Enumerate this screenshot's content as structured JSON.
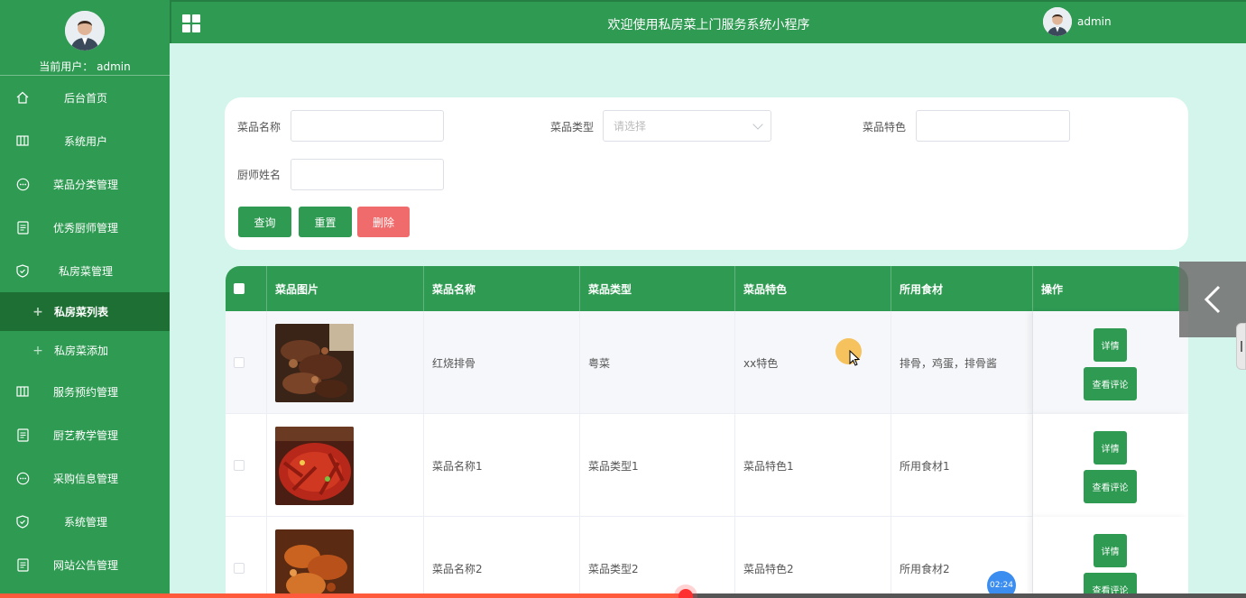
{
  "app": {
    "title": "欢迎使用私房菜上门服务系统小程序",
    "current_user_label": "当前用户： admin",
    "username": "admin"
  },
  "colors": {
    "primary": "#2e9a52",
    "active": "#1e6f34",
    "danger": "#f06b6b",
    "background": "#d4f5ec"
  },
  "sidebar": {
    "items": [
      {
        "label": "后台首页",
        "icon": "home-icon"
      },
      {
        "label": "系统用户",
        "icon": "columns-icon"
      },
      {
        "label": "菜品分类管理",
        "icon": "chat-icon"
      },
      {
        "label": "优秀厨师管理",
        "icon": "document-icon"
      },
      {
        "label": "私房菜管理",
        "icon": "shield-icon"
      }
    ],
    "sub_items": [
      {
        "label": "私房菜列表",
        "active": true
      },
      {
        "label": "私房菜添加",
        "active": false
      }
    ],
    "items_after": [
      {
        "label": "服务预约管理",
        "icon": "columns-icon"
      },
      {
        "label": "厨艺教学管理",
        "icon": "document-icon"
      },
      {
        "label": "采购信息管理",
        "icon": "chat-icon"
      },
      {
        "label": "系统管理",
        "icon": "shield-icon"
      },
      {
        "label": "网站公告管理",
        "icon": "document-icon"
      }
    ]
  },
  "search": {
    "name_label": "菜品名称",
    "type_label": "菜品类型",
    "type_placeholder": "请选择",
    "feature_label": "菜品特色",
    "chef_label": "厨师姓名",
    "query_button": "查询",
    "reset_button": "重置",
    "delete_button": "删除"
  },
  "table": {
    "headers": [
      "菜品图片",
      "菜品名称",
      "菜品类型",
      "菜品特色",
      "所用食材",
      "操作"
    ],
    "rows": [
      {
        "name": "红烧排骨",
        "type": "粤菜",
        "feature": "xx特色",
        "ingredients": "排骨，鸡蛋，排骨酱"
      },
      {
        "name": "菜品名称1",
        "type": "菜品类型1",
        "feature": "菜品特色1",
        "ingredients": "所用食材1"
      },
      {
        "name": "菜品名称2",
        "type": "菜品类型2",
        "feature": "菜品特色2",
        "ingredients": "所用食材2"
      }
    ],
    "detail_button": "详情",
    "comments_button": "查看评论"
  },
  "video": {
    "timer": "02:24",
    "progress": 0.55
  }
}
